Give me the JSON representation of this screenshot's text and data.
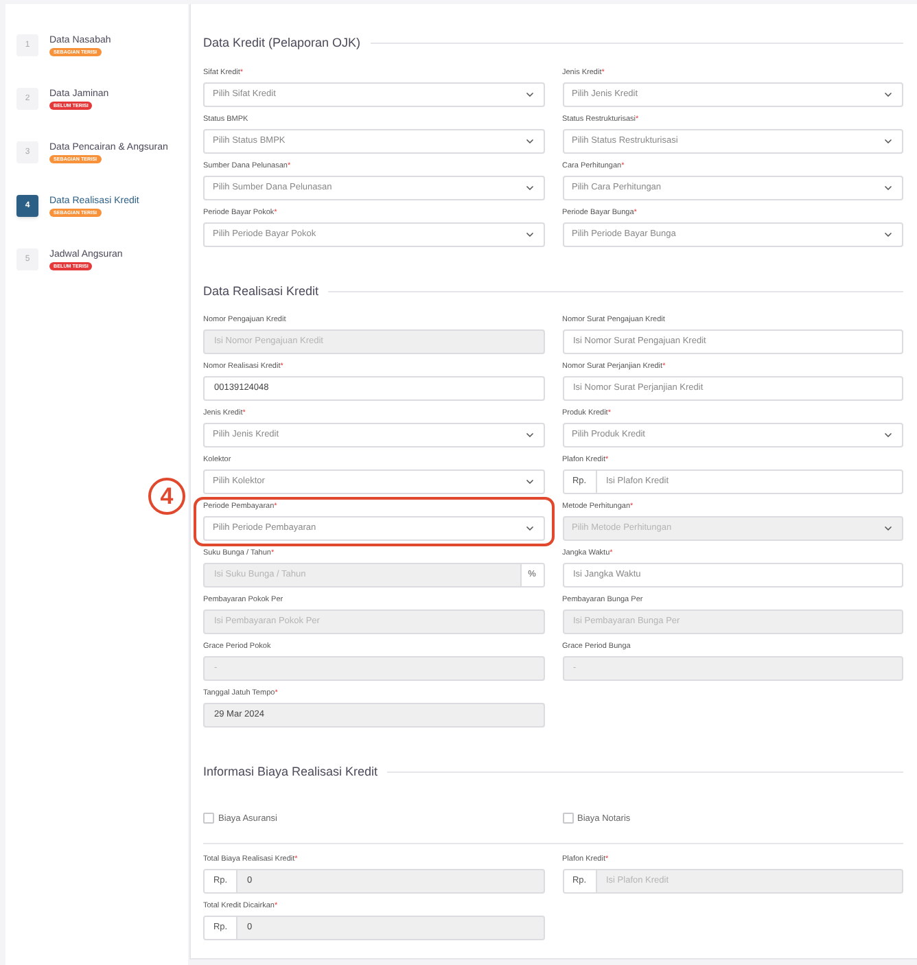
{
  "sidebar": {
    "steps": [
      {
        "number": "1",
        "title": "Data Nasabah",
        "status": "SEBAGIAN TERISI",
        "color": "#f7913a",
        "selected": false
      },
      {
        "number": "2",
        "title": "Data Jaminan",
        "status": "BELUM TERISI",
        "color": "#e5383b",
        "selected": false
      },
      {
        "number": "3",
        "title": "Data Pencairan & Angsuran",
        "status": "SEBAGIAN TERISI",
        "color": "#f7913a",
        "selected": false
      },
      {
        "number": "4",
        "title": "Data Realisasi Kredit",
        "status": "SEBAGIAN TERISI",
        "color": "#f7913a",
        "selected": true
      },
      {
        "number": "5",
        "title": "Jadwal Angsuran",
        "status": "BELUM TERISI",
        "color": "#e5383b",
        "selected": false
      }
    ]
  },
  "sections": [
    {
      "title": "Data Kredit (Pelaporan OJK)",
      "fields": [
        {
          "label": "Sifat Kredit",
          "required_mark": "*",
          "kind": "select",
          "placeholder": "Pilih Sifat Kredit",
          "disabled": false
        },
        {
          "label": "Jenis Kredit",
          "required_mark": "*",
          "kind": "select",
          "placeholder": "Pilih Jenis Kredit",
          "disabled": false
        },
        {
          "label": "Status BMPK",
          "kind": "select",
          "placeholder": "Pilih Status BMPK",
          "disabled": false
        },
        {
          "label": "Status Restrukturisasi",
          "required_mark": "*",
          "kind": "select",
          "placeholder": "Pilih Status Restrukturisasi",
          "disabled": false
        },
        {
          "label": "Sumber Dana Pelunasan",
          "required_mark": "*",
          "kind": "select",
          "placeholder": "Pilih Sumber Dana Pelunasan",
          "disabled": false
        },
        {
          "label": "Cara Perhitungan",
          "required_mark": "*",
          "kind": "select",
          "placeholder": "Pilih Cara Perhitungan",
          "disabled": false
        },
        {
          "label": "Periode Bayar Pokok",
          "required_mark": "*",
          "kind": "select",
          "placeholder": "Pilih Periode Bayar Pokok",
          "disabled": false
        },
        {
          "label": "Periode Bayar Bunga",
          "required_mark": "*",
          "kind": "select",
          "placeholder": "Pilih Periode Bayar Bunga",
          "disabled": false
        }
      ]
    },
    {
      "title": "Data Realisasi Kredit",
      "fields": [
        {
          "label": "Nomor Pengajuan Kredit",
          "kind": "input",
          "placeholder": "Isi Nomor Pengajuan Kredit",
          "disabled": true
        },
        {
          "label": "Nomor Surat Pengajuan Kredit",
          "kind": "input",
          "placeholder": "Isi Nomor Surat Pengajuan Kredit",
          "disabled": false
        },
        {
          "label": "Nomor Realisasi Kredit",
          "required_mark": "*",
          "kind": "input",
          "value": "00139124048",
          "disabled": false
        },
        {
          "label": "Nomor Surat Perjanjian Kredit",
          "required_mark": "*",
          "kind": "input",
          "placeholder": "Isi Nomor Surat Perjanjian Kredit",
          "disabled": false
        },
        {
          "label": "Jenis Kredit",
          "required_mark": "*",
          "kind": "select",
          "placeholder": "Pilih Jenis Kredit",
          "disabled": false
        },
        {
          "label": "Produk Kredit",
          "required_mark": "*",
          "kind": "select",
          "placeholder": "Pilih Produk Kredit",
          "disabled": false
        },
        {
          "label": "Kolektor",
          "kind": "select",
          "placeholder": "Pilih Kolektor",
          "disabled": false
        },
        {
          "label": "Plafon Kredit",
          "required_mark": "*",
          "kind": "prefix",
          "affix": "Rp.",
          "placeholder": "Isi Plafon Kredit",
          "disabled": false
        },
        {
          "label": "Periode Pembayaran",
          "required_mark": "*",
          "kind": "select",
          "placeholder": "Pilih Periode Pembayaran",
          "disabled": false,
          "annotation": "4"
        },
        {
          "label": "Metode Perhitungan",
          "required_mark": "*",
          "kind": "select",
          "placeholder": "Pilih Metode Perhitungan",
          "disabled": true
        },
        {
          "label": "Suku Bunga / Tahun",
          "required_mark": "*",
          "kind": "suffix",
          "affix": "%",
          "placeholder": "Isi Suku Bunga / Tahun",
          "disabled": true
        },
        {
          "label": "Jangka Waktu",
          "required_mark": "*",
          "kind": "input",
          "placeholder": "Isi Jangka Waktu",
          "disabled": false
        },
        {
          "label": "Pembayaran Pokok Per",
          "kind": "input",
          "placeholder": "Isi Pembayaran Pokok Per",
          "disabled": true
        },
        {
          "label": "Pembayaran Bunga Per",
          "kind": "input",
          "placeholder": "Isi Pembayaran Bunga Per",
          "disabled": true
        },
        {
          "label": "Grace Period Pokok",
          "kind": "input",
          "placeholder": "-",
          "disabled": true
        },
        {
          "label": "Grace Period Bunga",
          "kind": "input",
          "placeholder": "-",
          "disabled": true
        },
        {
          "label": "Tanggal Jatuh Tempo",
          "required_mark": "*",
          "kind": "input",
          "value": "29 Mar 2024",
          "disabled": true
        }
      ]
    },
    {
      "title": "Informasi Biaya Realisasi Kredit",
      "checkboxes": [
        {
          "label": "Biaya Asuransi",
          "checked": false
        },
        {
          "label": "Biaya Notaris",
          "checked": false
        }
      ],
      "fields": [
        {
          "label": "Total Biaya Realisasi Kredit",
          "required_mark": "*",
          "kind": "prefix",
          "affix": "Rp.",
          "value": "0",
          "disabled": true
        },
        {
          "label": "Plafon Kredit",
          "required_mark": "*",
          "kind": "prefix",
          "affix": "Rp.",
          "placeholder": "Isi Plafon Kredit",
          "disabled": true
        },
        {
          "label": "Total Kredit Dicairkan",
          "required_mark": "*",
          "kind": "prefix",
          "affix": "Rp.",
          "value": "0",
          "disabled": true
        }
      ]
    }
  ]
}
